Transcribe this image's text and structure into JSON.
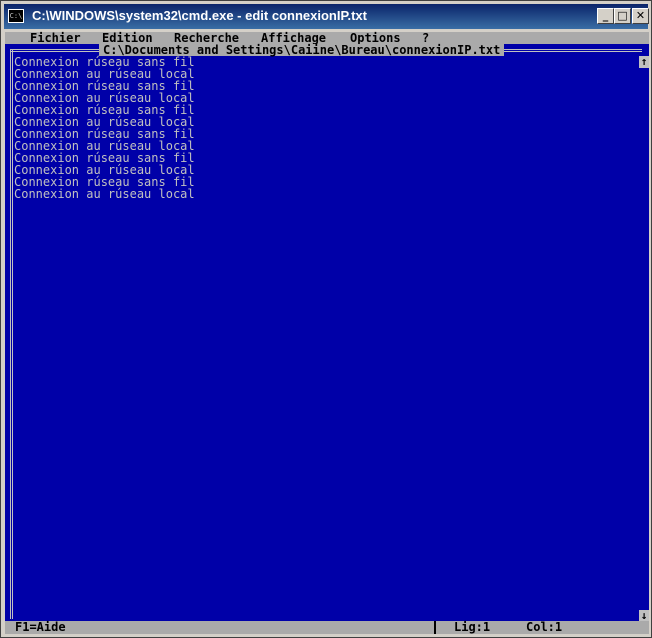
{
  "window": {
    "title": "C:\\WINDOWS\\system32\\cmd.exe - edit connexionIP.txt",
    "icon_label": "C:\\",
    "buttons": {
      "minimize": "_",
      "maximize": "□",
      "close": "✕"
    }
  },
  "menu": {
    "items": [
      "Fichier",
      "Edition",
      "Recherche",
      "Affichage",
      "Options",
      "?"
    ]
  },
  "file_path": "C:\\Documents and Settings\\Caiine\\Bureau\\connexionIP.txt",
  "editor": {
    "lines": [
      "Connexion rúseau sans fil",
      "Connexion au rúseau local",
      "Connexion rúseau sans fil",
      "Connexion au rúseau local",
      "Connexion rúseau sans fil",
      "Connexion au rúseau local",
      "Connexion rúseau sans fil",
      "Connexion au rúseau local",
      "Connexion rúseau sans fil",
      "Connexion au rúseau local",
      "Connexion rúseau sans fil",
      "Connexion au rúseau local"
    ]
  },
  "scrollbar": {
    "up": "↑",
    "down": "↓"
  },
  "status": {
    "help": "F1=Aide",
    "line": "Lig:1",
    "col": "Col:1"
  },
  "colors": {
    "title_bar": "#0a246a",
    "console_bg": "#0000a8",
    "text": "#c0c0c0",
    "menu_bg": "#aaaaaa"
  }
}
